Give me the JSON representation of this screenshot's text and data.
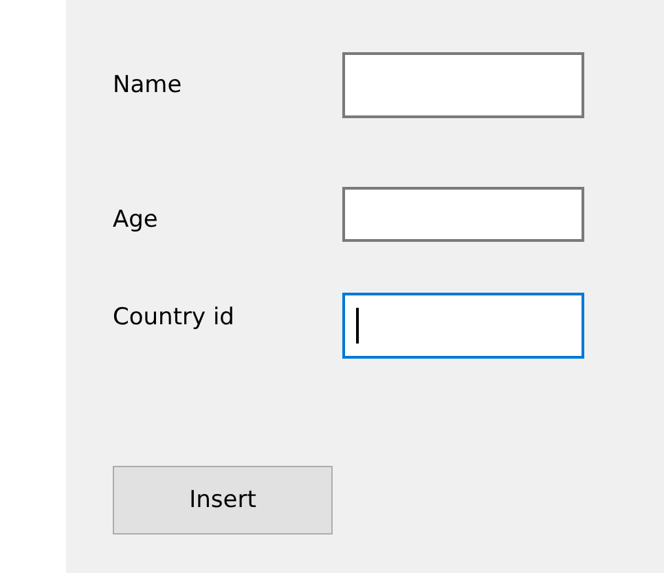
{
  "fields": [
    {
      "label": "Name",
      "focused": false
    },
    {
      "label": "Age",
      "focused": false
    },
    {
      "label": "Country id",
      "focused": true
    }
  ],
  "button": "Insert"
}
